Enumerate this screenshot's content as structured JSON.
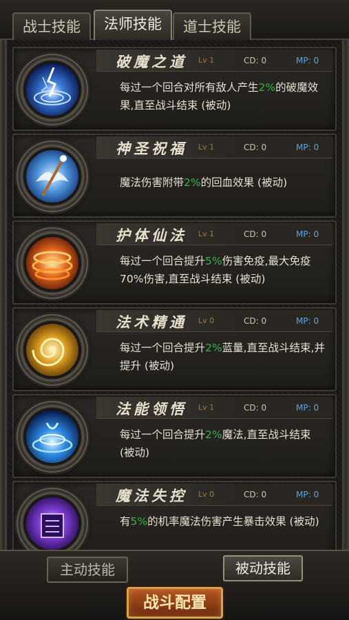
{
  "tabs": [
    {
      "label": "战士技能",
      "active": false
    },
    {
      "label": "法师技能",
      "active": true
    },
    {
      "label": "道士技能",
      "active": false
    }
  ],
  "skills": [
    {
      "name": "破魔之道",
      "level": "Lv 1",
      "cd": "CD: 0",
      "mp": "MP: 0",
      "desc_before": "每过一个回合对所有敌人产生",
      "pct": "2%",
      "desc_after": "的破魔效果,直至战斗结束 (被动)",
      "icon": "lightning-sigil-icon"
    },
    {
      "name": "神圣祝福",
      "level": "Lv 1",
      "cd": "CD: 0",
      "mp": "MP: 0",
      "desc_before": "魔法伤害附带",
      "pct": "2%",
      "desc_after": "的回血效果 (被动)",
      "icon": "winged-staff-icon"
    },
    {
      "name": "护体仙法",
      "level": "Lv 1",
      "cd": "CD: 0",
      "mp": "MP: 0",
      "desc_before": "每过一个回合提升",
      "pct": "5%",
      "desc_after": "伤害免疫,最大免疫70%伤害,直至战斗结束 (被动)",
      "icon": "fire-shield-icon"
    },
    {
      "name": "法术精通",
      "level": "Lv 0",
      "cd": "CD: 0",
      "mp": "MP: 0",
      "desc_before": "每过一个回合提升",
      "pct": "2%",
      "desc_after": "蓝量,直至战斗结束,并提升 (被动)",
      "icon": "golden-swirl-icon"
    },
    {
      "name": "法能领悟",
      "level": "Lv 1",
      "cd": "CD: 0",
      "mp": "MP: 0",
      "desc_before": "每过一个回合提升",
      "pct": "2%",
      "desc_after": "魔法,直至战斗结束 (被动)",
      "icon": "blue-vortex-icon"
    },
    {
      "name": "魔法失控",
      "level": "Lv 0",
      "cd": "CD: 0",
      "mp": "MP: 0",
      "desc_before": "有",
      "pct": "5%",
      "desc_after": "的机率魔法伤害产生暴击效果 (被动)",
      "icon": "purple-rune-icon"
    }
  ],
  "bottom": {
    "active_skill_label": "主动技能",
    "passive_skill_label": "被动技能",
    "battle_config_label": "战斗配置"
  },
  "colors": {
    "percent": "#35b24a",
    "mp": "#5fa2d9",
    "level": "#9c7c3a"
  }
}
